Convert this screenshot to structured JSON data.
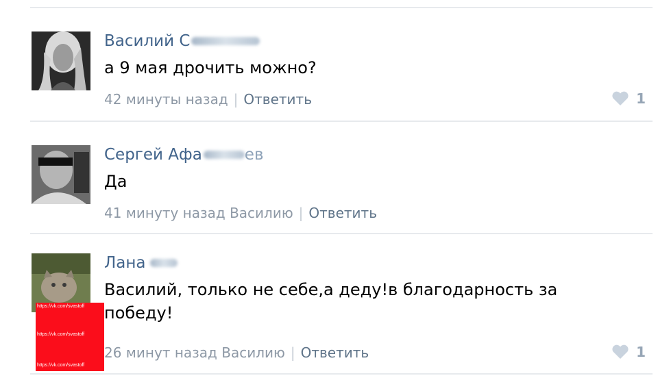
{
  "comments": [
    {
      "author": "Василий С",
      "text": "а 9 мая дрочить можно?",
      "time": "42 минуты назад",
      "reply_to": "",
      "reply_label": "Ответить",
      "likes": "1"
    },
    {
      "author": "Сергей Афа",
      "author_tail": "ев",
      "text": "Да",
      "time": "41 минуту назад",
      "reply_to": "Василию",
      "reply_label": "Ответить",
      "likes": ""
    },
    {
      "author": "Лана",
      "text": "Василий, только не себе,а деду!в благодарность за победу!",
      "time": "26 минут назад",
      "reply_to": "Василию",
      "reply_label": "Ответить",
      "likes": "1"
    }
  ],
  "watermark": {
    "line1": "https://vk.com/svastoff",
    "line2": "https://vk.com/svastoff",
    "line3": "https://vk.com/svastoff",
    "color": "#fb0d1b"
  },
  "icons": {
    "like": "heart-icon"
  }
}
